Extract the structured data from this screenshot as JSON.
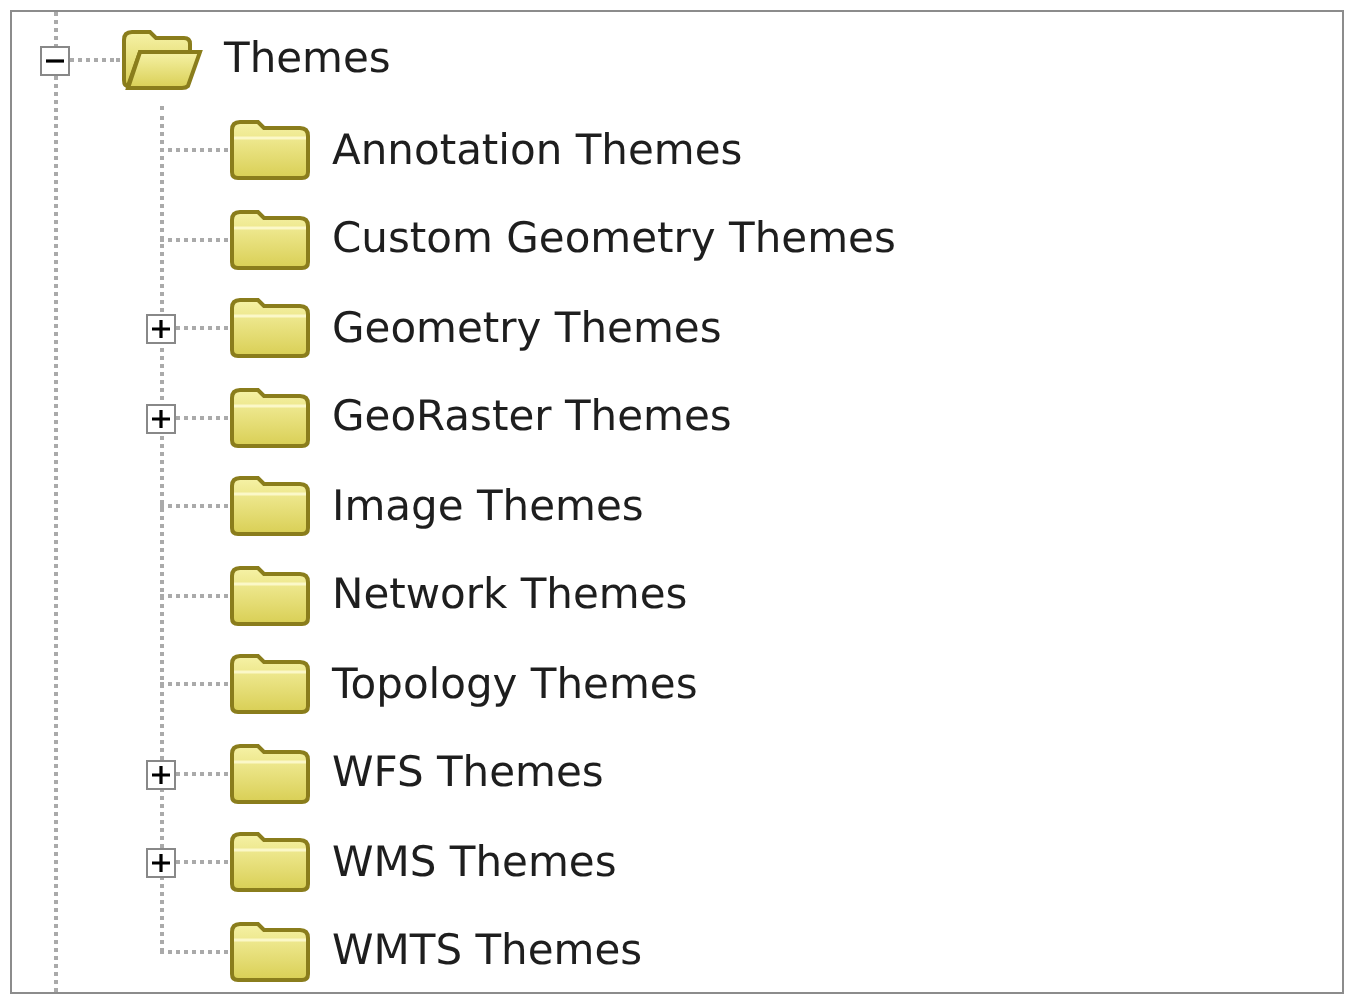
{
  "tree": {
    "label": "Themes",
    "expanded": true,
    "children": [
      {
        "label": "Annotation Themes",
        "kind": "leaf"
      },
      {
        "label": "Custom Geometry Themes",
        "kind": "leaf"
      },
      {
        "label": "Geometry Themes",
        "kind": "branch",
        "expanded": false
      },
      {
        "label": "GeoRaster Themes",
        "kind": "branch",
        "expanded": false
      },
      {
        "label": "Image Themes",
        "kind": "leaf"
      },
      {
        "label": "Network Themes",
        "kind": "leaf"
      },
      {
        "label": "Topology Themes",
        "kind": "leaf"
      },
      {
        "label": "WFS Themes",
        "kind": "branch",
        "expanded": false
      },
      {
        "label": "WMS Themes",
        "kind": "branch",
        "expanded": false
      },
      {
        "label": "WMTS Themes",
        "kind": "leaf"
      }
    ]
  }
}
